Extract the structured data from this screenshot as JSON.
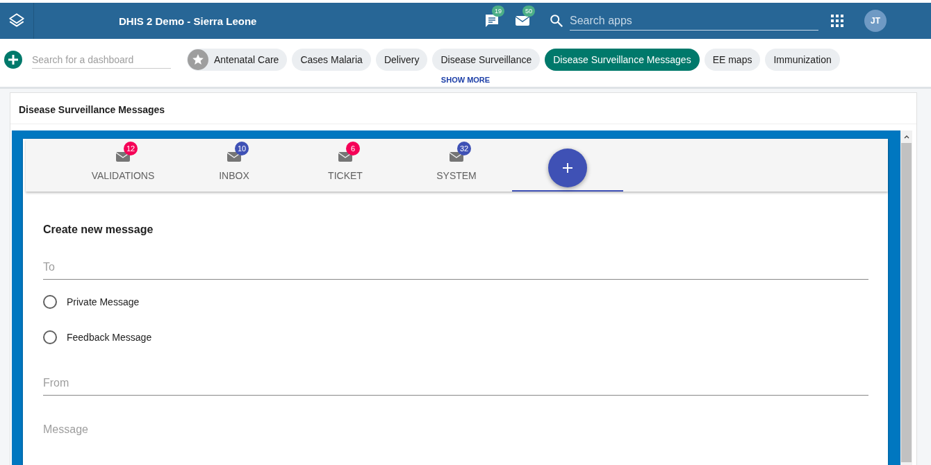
{
  "header": {
    "title": "DHIS 2 Demo - Sierra Leone",
    "interpretations_count": "19",
    "messages_count": "50",
    "search": {
      "placeholder": "Search apps"
    },
    "avatar": "JT"
  },
  "dashboard_bar": {
    "search": {
      "placeholder": "Search for a dashboard"
    },
    "dashboards": [
      {
        "label": "Antenatal Care",
        "starred": true,
        "selected": false
      },
      {
        "label": "Cases Malaria",
        "starred": false,
        "selected": false
      },
      {
        "label": "Delivery",
        "starred": false,
        "selected": false
      },
      {
        "label": "Disease Surveillance",
        "starred": false,
        "selected": false
      },
      {
        "label": "Disease Surveillance Messages",
        "starred": false,
        "selected": true
      },
      {
        "label": "EE maps",
        "starred": false,
        "selected": false
      },
      {
        "label": "Immunization",
        "starred": false,
        "selected": false
      }
    ],
    "show_more": "SHOW MORE"
  },
  "item": {
    "title": "Disease Surveillance Messages",
    "tabs": [
      {
        "kind": "folder",
        "label": "VALIDATIONS",
        "count": "12",
        "color": "#f50057",
        "selected": false
      },
      {
        "kind": "folder",
        "label": "INBOX",
        "count": "10",
        "color": "#3f51b5",
        "selected": false
      },
      {
        "kind": "folder",
        "label": "TICKET",
        "count": "6",
        "color": "#f50057",
        "selected": false
      },
      {
        "kind": "folder",
        "label": "SYSTEM",
        "count": "32",
        "color": "#3f51b5",
        "selected": false
      },
      {
        "kind": "compose",
        "selected": true
      }
    ],
    "form": {
      "heading": "Create new message",
      "to": {
        "placeholder": "To"
      },
      "options": [
        {
          "label": "Private Message",
          "checked": false
        },
        {
          "label": "Feedback Message",
          "checked": false
        }
      ],
      "from": {
        "placeholder": "From"
      },
      "message": {
        "placeholder": "Message"
      }
    }
  }
}
